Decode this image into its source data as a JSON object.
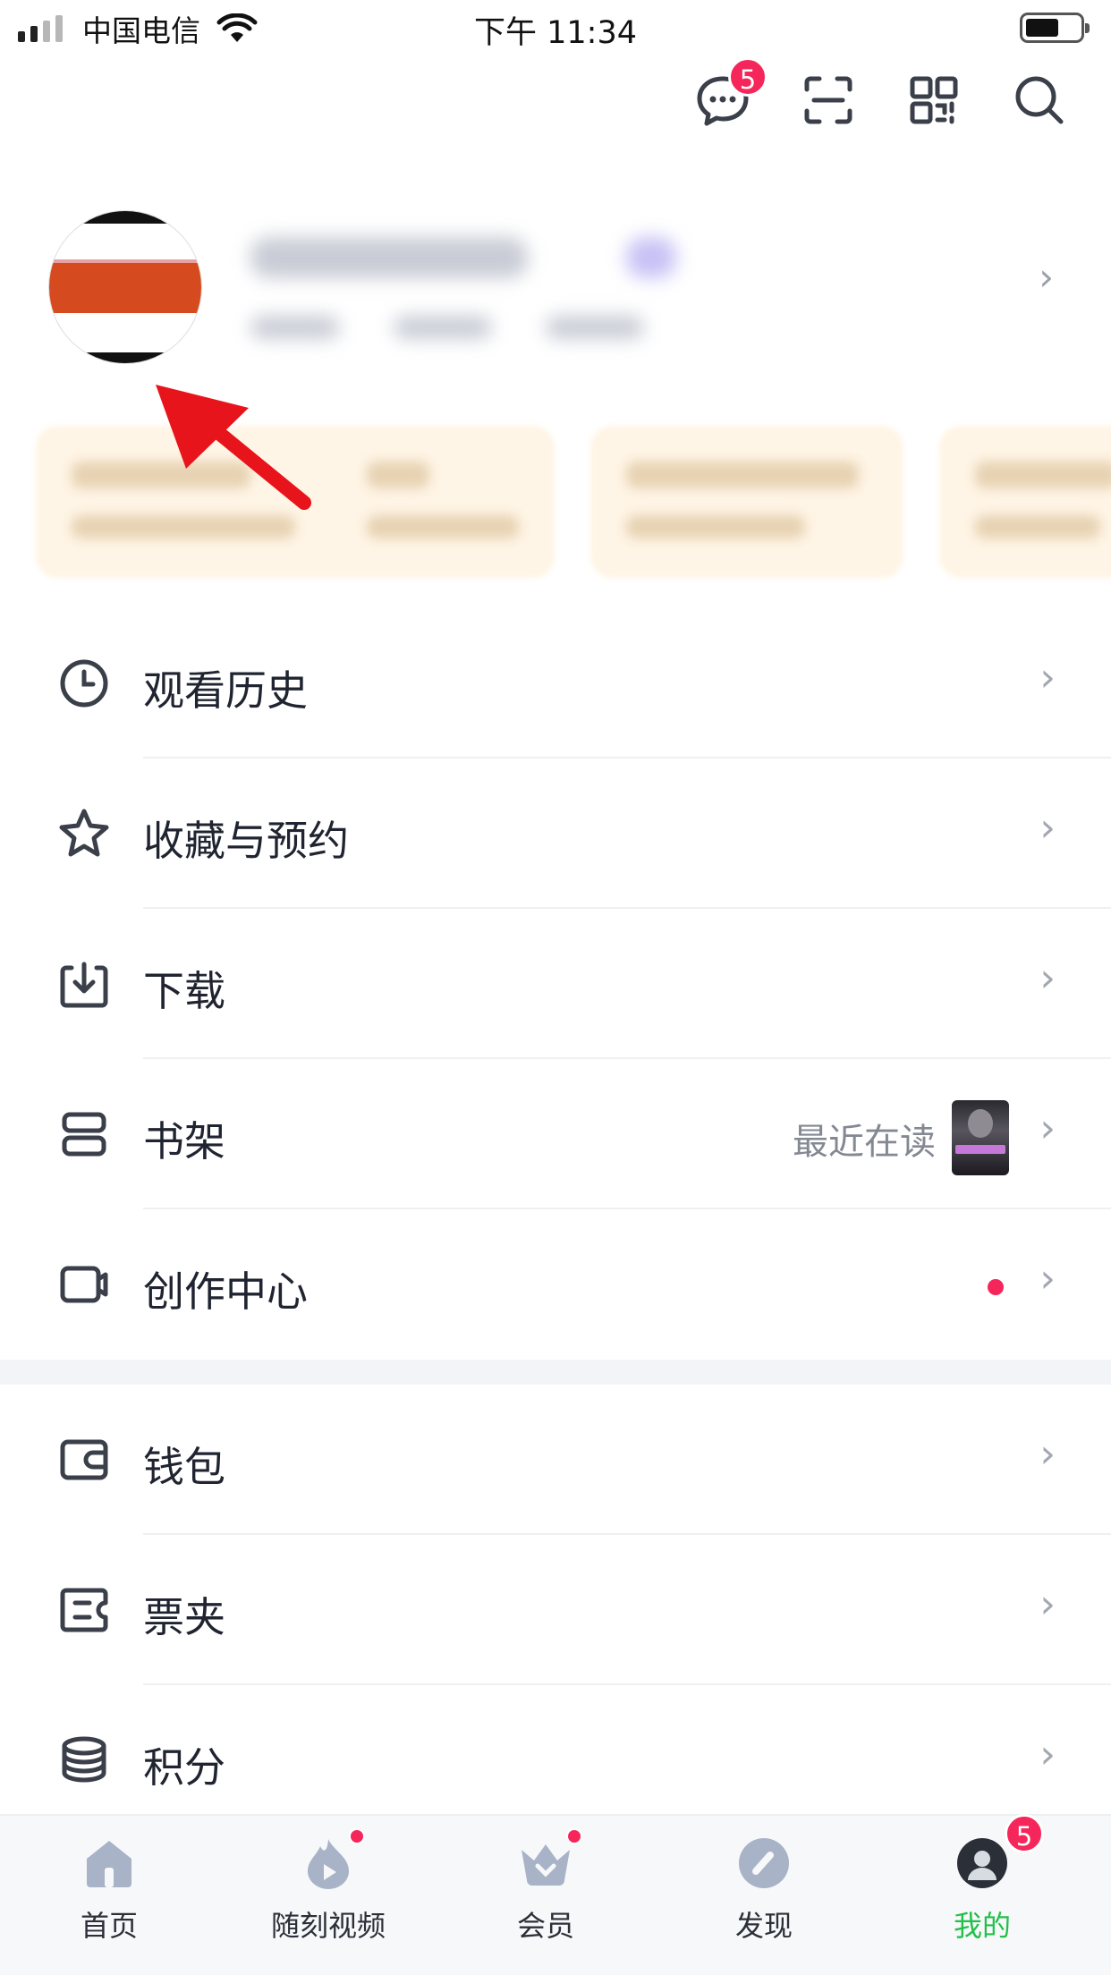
{
  "status_bar": {
    "carrier": "中国电信",
    "time": "下午 11:34"
  },
  "header": {
    "icons": [
      "message-icon",
      "scan-icon",
      "qrcode-icon",
      "search-icon"
    ],
    "message_badge": "5"
  },
  "menu_group_1": [
    {
      "label": "观看历史",
      "icon": "clock-icon"
    },
    {
      "label": "收藏与预约",
      "icon": "star-icon"
    },
    {
      "label": "下载",
      "icon": "download-icon"
    },
    {
      "label": "书架",
      "icon": "bookshelf-icon",
      "extra": "最近在读"
    },
    {
      "label": "创作中心",
      "icon": "video-camera-icon"
    }
  ],
  "menu_group_2": [
    {
      "label": "钱包",
      "icon": "wallet-icon"
    },
    {
      "label": "票夹",
      "icon": "ticket-icon"
    },
    {
      "label": "积分",
      "icon": "coins-icon"
    }
  ],
  "tabbar": {
    "tabs": [
      {
        "label": "首页",
        "icon": "home-icon"
      },
      {
        "label": "随刻视频",
        "icon": "flame-play-icon"
      },
      {
        "label": "会员",
        "icon": "crown-icon"
      },
      {
        "label": "发现",
        "icon": "compass-icon"
      },
      {
        "label": "我的",
        "icon": "profile-icon"
      }
    ],
    "profile_badge": "5"
  },
  "colors": {
    "accent_green": "#22c04a",
    "badge_red": "#f5265a",
    "arrow_red": "#e8141c"
  }
}
